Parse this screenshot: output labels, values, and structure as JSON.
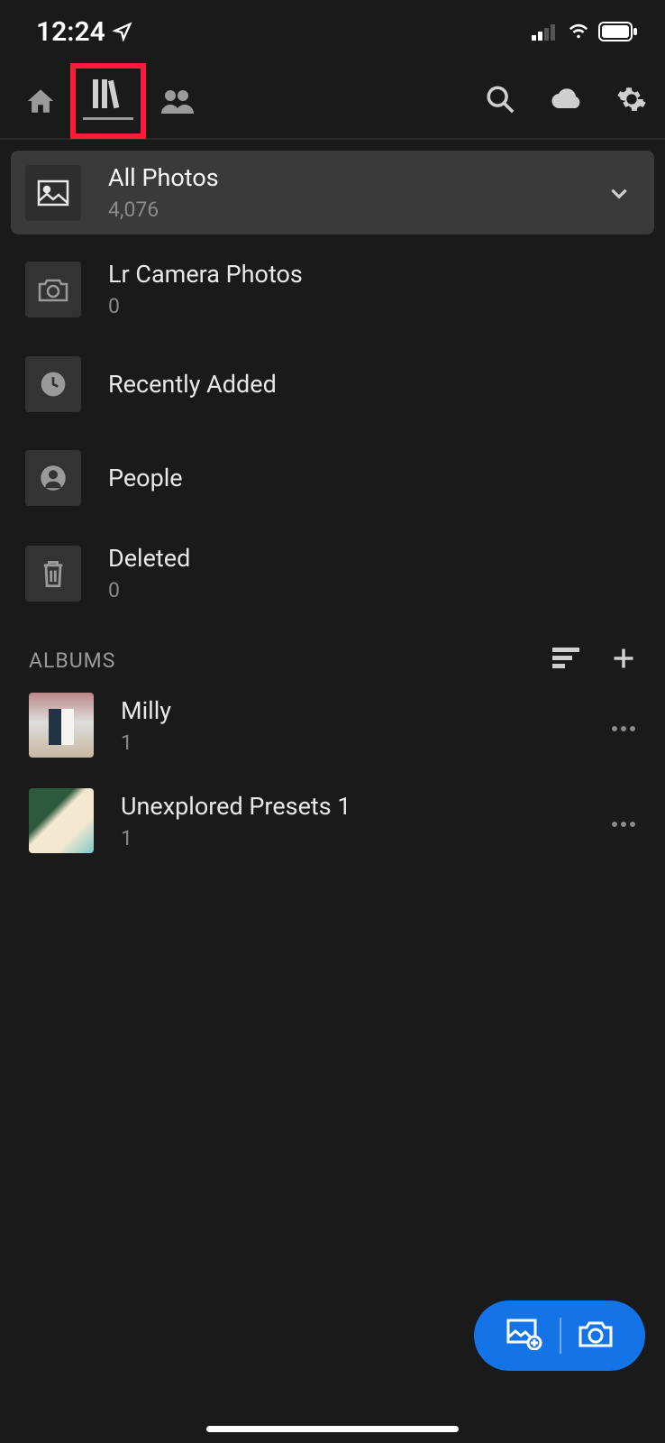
{
  "statusBar": {
    "time": "12:24"
  },
  "collections": {
    "allPhotos": {
      "title": "All Photos",
      "count": "4,076"
    },
    "lrCamera": {
      "title": "Lr Camera Photos",
      "count": "0"
    },
    "recent": {
      "title": "Recently Added"
    },
    "people": {
      "title": "People"
    },
    "deleted": {
      "title": "Deleted",
      "count": "0"
    }
  },
  "albumsHeader": {
    "title": "ALBUMS"
  },
  "albums": [
    {
      "title": "Milly",
      "count": "1"
    },
    {
      "title": "Unexplored Presets 1",
      "count": "1"
    }
  ]
}
